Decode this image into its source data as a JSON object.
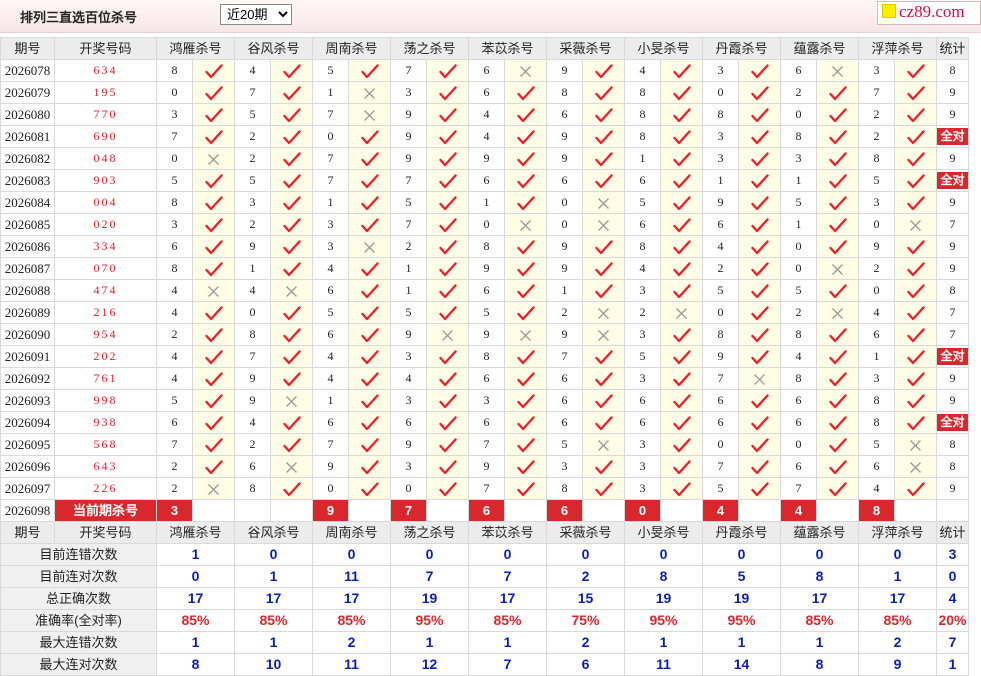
{
  "header": {
    "title": "排列三直选百位杀号",
    "period_selected": "近20期",
    "period_options": [
      "近20期"
    ],
    "logo_text": "cz89.com"
  },
  "columns": {
    "issue": "期号",
    "draw": "开奖号码",
    "experts": [
      "鸿雁杀号",
      "谷风杀号",
      "周南杀号",
      "荡之杀号",
      "苯苡杀号",
      "采薇杀号",
      "小旻杀号",
      "丹霞杀号",
      "蕴露杀号",
      "浮萍杀号"
    ],
    "stat": "统计"
  },
  "colors": {
    "hit": "#e8232d",
    "miss": "#999999",
    "accent": "#d9272e",
    "value_blue": "#0a1fb0"
  },
  "rows": [
    {
      "issue": "2026078",
      "draw": "634",
      "kills": [
        "8",
        "4",
        "5",
        "7",
        "6",
        "9",
        "4",
        "3",
        "6",
        "3"
      ],
      "hits": [
        1,
        1,
        1,
        1,
        0,
        1,
        1,
        1,
        0,
        1
      ],
      "stat": "8"
    },
    {
      "issue": "2026079",
      "draw": "195",
      "kills": [
        "0",
        "7",
        "1",
        "3",
        "6",
        "8",
        "8",
        "0",
        "2",
        "7"
      ],
      "hits": [
        1,
        1,
        0,
        1,
        1,
        1,
        1,
        1,
        1,
        1
      ],
      "stat": "9"
    },
    {
      "issue": "2026080",
      "draw": "770",
      "kills": [
        "3",
        "5",
        "7",
        "9",
        "4",
        "6",
        "8",
        "8",
        "0",
        "2"
      ],
      "hits": [
        1,
        1,
        0,
        1,
        1,
        1,
        1,
        1,
        1,
        1
      ],
      "stat": "9"
    },
    {
      "issue": "2026081",
      "draw": "690",
      "kills": [
        "7",
        "2",
        "0",
        "9",
        "4",
        "9",
        "8",
        "3",
        "8",
        "2"
      ],
      "hits": [
        1,
        1,
        1,
        1,
        1,
        1,
        1,
        1,
        1,
        1
      ],
      "stat": "全对"
    },
    {
      "issue": "2026082",
      "draw": "048",
      "kills": [
        "0",
        "2",
        "7",
        "9",
        "9",
        "9",
        "1",
        "3",
        "3",
        "8"
      ],
      "hits": [
        0,
        1,
        1,
        1,
        1,
        1,
        1,
        1,
        1,
        1
      ],
      "stat": "9"
    },
    {
      "issue": "2026083",
      "draw": "903",
      "kills": [
        "5",
        "5",
        "7",
        "7",
        "6",
        "6",
        "6",
        "1",
        "1",
        "5"
      ],
      "hits": [
        1,
        1,
        1,
        1,
        1,
        1,
        1,
        1,
        1,
        1
      ],
      "stat": "全对"
    },
    {
      "issue": "2026084",
      "draw": "004",
      "kills": [
        "8",
        "3",
        "1",
        "5",
        "1",
        "0",
        "5",
        "9",
        "5",
        "3"
      ],
      "hits": [
        1,
        1,
        1,
        1,
        1,
        0,
        1,
        1,
        1,
        1
      ],
      "stat": "9"
    },
    {
      "issue": "2026085",
      "draw": "020",
      "kills": [
        "3",
        "2",
        "3",
        "7",
        "0",
        "0",
        "6",
        "6",
        "1",
        "0"
      ],
      "hits": [
        1,
        1,
        1,
        1,
        0,
        0,
        1,
        1,
        1,
        0
      ],
      "stat": "7"
    },
    {
      "issue": "2026086",
      "draw": "334",
      "kills": [
        "6",
        "9",
        "3",
        "2",
        "8",
        "9",
        "8",
        "4",
        "0",
        "9"
      ],
      "hits": [
        1,
        1,
        0,
        1,
        1,
        1,
        1,
        1,
        1,
        1
      ],
      "stat": "9"
    },
    {
      "issue": "2026087",
      "draw": "070",
      "kills": [
        "8",
        "1",
        "4",
        "1",
        "9",
        "9",
        "4",
        "2",
        "0",
        "2"
      ],
      "hits": [
        1,
        1,
        1,
        1,
        1,
        1,
        1,
        1,
        0,
        1
      ],
      "stat": "9"
    },
    {
      "issue": "2026088",
      "draw": "474",
      "kills": [
        "4",
        "4",
        "6",
        "1",
        "6",
        "1",
        "3",
        "5",
        "5",
        "0"
      ],
      "hits": [
        0,
        0,
        1,
        1,
        1,
        1,
        1,
        1,
        1,
        1
      ],
      "stat": "8"
    },
    {
      "issue": "2026089",
      "draw": "216",
      "kills": [
        "4",
        "0",
        "5",
        "5",
        "5",
        "2",
        "2",
        "0",
        "2",
        "4"
      ],
      "hits": [
        1,
        1,
        1,
        1,
        1,
        0,
        0,
        1,
        0,
        1
      ],
      "stat": "7"
    },
    {
      "issue": "2026090",
      "draw": "954",
      "kills": [
        "2",
        "8",
        "6",
        "9",
        "9",
        "9",
        "3",
        "8",
        "8",
        "6"
      ],
      "hits": [
        1,
        1,
        1,
        0,
        0,
        0,
        1,
        1,
        1,
        1
      ],
      "stat": "7"
    },
    {
      "issue": "2026091",
      "draw": "202",
      "kills": [
        "4",
        "7",
        "4",
        "3",
        "8",
        "7",
        "5",
        "9",
        "4",
        "1"
      ],
      "hits": [
        1,
        1,
        1,
        1,
        1,
        1,
        1,
        1,
        1,
        1
      ],
      "stat": "全对"
    },
    {
      "issue": "2026092",
      "draw": "761",
      "kills": [
        "4",
        "9",
        "4",
        "4",
        "6",
        "6",
        "3",
        "7",
        "8",
        "3"
      ],
      "hits": [
        1,
        1,
        1,
        1,
        1,
        1,
        1,
        0,
        1,
        1
      ],
      "stat": "9"
    },
    {
      "issue": "2026093",
      "draw": "998",
      "kills": [
        "5",
        "9",
        "1",
        "3",
        "3",
        "6",
        "6",
        "6",
        "6",
        "8"
      ],
      "hits": [
        1,
        0,
        1,
        1,
        1,
        1,
        1,
        1,
        1,
        1
      ],
      "stat": "9"
    },
    {
      "issue": "2026094",
      "draw": "938",
      "kills": [
        "6",
        "4",
        "6",
        "6",
        "6",
        "6",
        "6",
        "6",
        "6",
        "8"
      ],
      "hits": [
        1,
        1,
        1,
        1,
        1,
        1,
        1,
        1,
        1,
        1
      ],
      "stat": "全对"
    },
    {
      "issue": "2026095",
      "draw": "568",
      "kills": [
        "7",
        "2",
        "7",
        "9",
        "7",
        "5",
        "3",
        "0",
        "0",
        "5"
      ],
      "hits": [
        1,
        1,
        1,
        1,
        1,
        0,
        1,
        1,
        1,
        0
      ],
      "stat": "8"
    },
    {
      "issue": "2026096",
      "draw": "643",
      "kills": [
        "2",
        "6",
        "9",
        "3",
        "9",
        "3",
        "3",
        "7",
        "6",
        "6"
      ],
      "hits": [
        1,
        0,
        1,
        1,
        1,
        1,
        1,
        1,
        1,
        0
      ],
      "stat": "8"
    },
    {
      "issue": "2026097",
      "draw": "226",
      "kills": [
        "2",
        "8",
        "0",
        "0",
        "7",
        "8",
        "3",
        "5",
        "7",
        "4"
      ],
      "hits": [
        0,
        1,
        1,
        1,
        1,
        1,
        1,
        1,
        1,
        1
      ],
      "stat": "9"
    }
  ],
  "current": {
    "issue": "2026098",
    "label": "当前期杀号",
    "kills": [
      "3",
      "",
      "9",
      "7",
      "6",
      "6",
      "0",
      "4",
      "4",
      "8"
    ]
  },
  "stats": [
    {
      "label": "目前连错次数",
      "values": [
        "1",
        "0",
        "0",
        "0",
        "0",
        "0",
        "0",
        "0",
        "0",
        "0",
        "3"
      ]
    },
    {
      "label": "目前连对次数",
      "values": [
        "0",
        "1",
        "11",
        "7",
        "7",
        "2",
        "8",
        "5",
        "8",
        "1",
        "0"
      ]
    },
    {
      "label": "总正确次数",
      "values": [
        "17",
        "17",
        "17",
        "19",
        "17",
        "15",
        "19",
        "19",
        "17",
        "17",
        "4"
      ]
    },
    {
      "label": "准确率(全对率)",
      "values": [
        "85%",
        "85%",
        "85%",
        "95%",
        "85%",
        "75%",
        "95%",
        "95%",
        "85%",
        "85%",
        "20%"
      ],
      "rate": true
    },
    {
      "label": "最大连错次数",
      "values": [
        "1",
        "1",
        "2",
        "1",
        "1",
        "2",
        "1",
        "1",
        "1",
        "2",
        "7"
      ]
    },
    {
      "label": "最大连对次数",
      "values": [
        "8",
        "10",
        "11",
        "12",
        "7",
        "6",
        "11",
        "14",
        "8",
        "9",
        "1"
      ]
    }
  ]
}
